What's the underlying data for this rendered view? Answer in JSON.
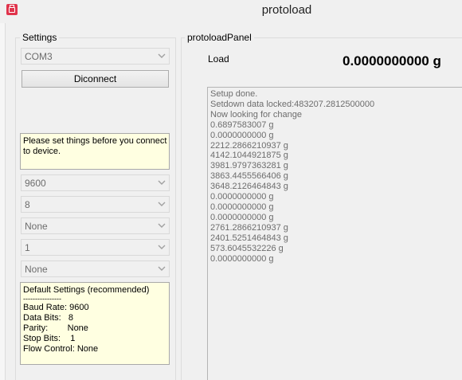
{
  "window": {
    "title": "protoload"
  },
  "settings": {
    "group_label": "Settings",
    "port": "COM3",
    "disconnect_label": "Diconnect",
    "info_lines": [
      "Please set things before you connect",
      "to device."
    ],
    "baud": "9600",
    "data_bits": "8",
    "parity": "None",
    "stop_bits": "1",
    "flow": "None",
    "defaults_lines": [
      "Default Settings (recommended)",
      "----------------",
      "Baud Rate: 9600",
      "Data Bits:   8",
      "Parity:        None",
      "Stop Bits:    1",
      "Flow Control: None"
    ]
  },
  "panel": {
    "group_label": "protoloadPanel",
    "load_label": "Load",
    "load_value": "0.0000000000 g",
    "log": [
      "Setup done.",
      "Setdown data locked:483207.2812500000",
      "Now looking for change",
      "0.6897583007 g",
      "0.0000000000 g",
      "2212.2866210937 g",
      "4142.1044921875 g",
      "3981.9797363281 g",
      "3863.4455566406 g",
      "3648.2126464843 g",
      "0.0000000000 g",
      "0.0000000000 g",
      "0.0000000000 g",
      "2761.2866210937 g",
      "2401.5251464843 g",
      "573.6045532226 g",
      "0.0000000000 g"
    ]
  },
  "colors": {
    "accent_icon": "#e0344c",
    "note_background": "#ffffe1",
    "disabled_text": "#6d6d6d"
  }
}
